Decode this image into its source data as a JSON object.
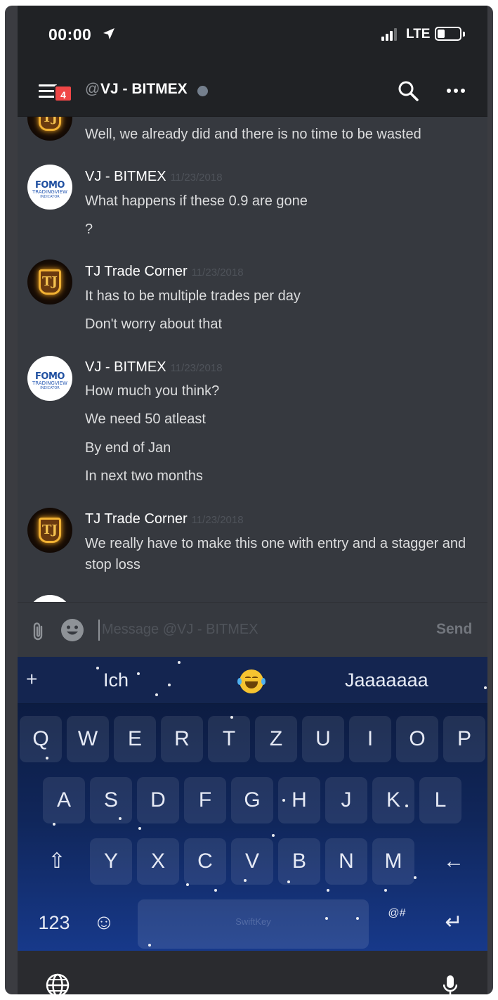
{
  "status_bar": {
    "time": "00:00",
    "network": "LTE",
    "battery_level": 0.3,
    "signal_bars": 3
  },
  "header": {
    "unread_badge": "4",
    "at_symbol": "@",
    "channel_name": "VJ - BITMEX",
    "user_status": "offline"
  },
  "messages": [
    {
      "author": "",
      "avatar": "tj-trade-corner",
      "timestamp": "",
      "lines": [
        "Well, we already did and there is no time to be wasted"
      ]
    },
    {
      "author": "VJ - BITMEX",
      "avatar": "fomo",
      "timestamp": "11/23/2018",
      "lines": [
        "What happens if these 0.9 are gone",
        "?"
      ]
    },
    {
      "author": "TJ Trade Corner",
      "avatar": "tj-trade-corner",
      "timestamp": "11/23/2018",
      "lines": [
        "It has to be multiple trades per day",
        "Don't worry about that"
      ]
    },
    {
      "author": "VJ - BITMEX",
      "avatar": "fomo",
      "timestamp": "11/23/2018",
      "lines": [
        "How much you think?",
        "We need 50 atleast",
        "By end of Jan",
        "In next two months"
      ]
    },
    {
      "author": "TJ Trade Corner",
      "avatar": "tj-trade-corner",
      "timestamp": "11/23/2018",
      "lines": [
        "We really have to make this one with entry and a stagger and stop loss"
      ]
    }
  ],
  "avatars": {
    "fomo_top": "FOMO",
    "fomo_mid": "TRADINGVIEW",
    "fomo_bot": "INDICATOR",
    "tj": "TJ"
  },
  "composer": {
    "placeholder": "Message @VJ - BITMEX",
    "value": "",
    "send_label": "Send"
  },
  "keyboard": {
    "suggestions": [
      "Ich",
      "Jaaaaaaa"
    ],
    "suggestion_emoji": "face-with-tears-of-joy",
    "rows": [
      [
        "Q",
        "W",
        "E",
        "R",
        "T",
        "Z",
        "U",
        "I",
        "O",
        "P"
      ],
      [
        "A",
        "S",
        "D",
        "F",
        "G",
        "H",
        "J",
        "K",
        "L"
      ],
      [
        "Y",
        "X",
        "C",
        "V",
        "B",
        "N",
        "M"
      ]
    ],
    "shift": "⇧",
    "backspace": "←",
    "numbers_key": "123",
    "emoji_key": "☺",
    "symbols_key": "@#",
    "enter_key": "↵",
    "brand": "SwiftKey"
  },
  "colors": {
    "accent_badge": "#f04747",
    "background": "#36393f",
    "header": "#202225",
    "username": "#ffffff",
    "message_text": "#dcddde",
    "keyboard_top": "#0b1838",
    "keyboard_bottom": "#17398a"
  }
}
